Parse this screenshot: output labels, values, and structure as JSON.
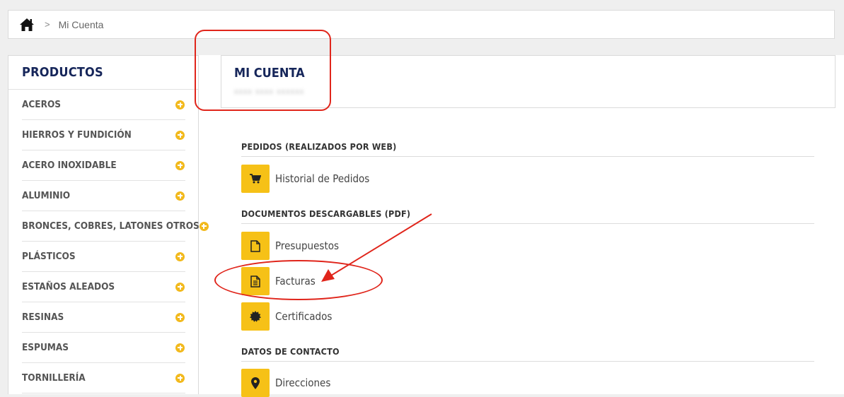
{
  "breadcrumb": {
    "separator": ">",
    "current": "Mi Cuenta"
  },
  "sidebar": {
    "title": "PRODUCTOS",
    "items": [
      {
        "label": "ACEROS"
      },
      {
        "label": "HIERROS Y FUNDICIÓN"
      },
      {
        "label": "ACERO INOXIDABLE"
      },
      {
        "label": "ALUMINIO"
      },
      {
        "label": "BRONCES, COBRES, LATONES OTROS"
      },
      {
        "label": "PLÁSTICOS"
      },
      {
        "label": "ESTAÑOS ALEADOS"
      },
      {
        "label": "RESINAS"
      },
      {
        "label": "ESPUMAS"
      },
      {
        "label": "TORNILLERÍA"
      }
    ]
  },
  "account": {
    "title": "MI CUENTA",
    "subtitle_redacted": "xxxx xxxx xxxxxx"
  },
  "sections": {
    "orders": {
      "title": "PEDIDOS (REALIZADOS POR WEB)",
      "items": [
        {
          "label": "Historial de Pedidos",
          "icon": "cart-icon"
        }
      ]
    },
    "documents": {
      "title": "DOCUMENTOS DESCARGABLES (PDF)",
      "items": [
        {
          "label": "Presupuestos",
          "icon": "document-icon"
        },
        {
          "label": "Facturas",
          "icon": "invoice-icon"
        },
        {
          "label": "Certificados",
          "icon": "certificate-icon"
        }
      ]
    },
    "contact": {
      "title": "DATOS DE CONTACTO",
      "items": [
        {
          "label": "Direcciones",
          "icon": "location-pin-icon"
        }
      ]
    }
  },
  "colors": {
    "accent": "#f6c117",
    "title": "#16265a",
    "annotation": "#e0251b"
  }
}
